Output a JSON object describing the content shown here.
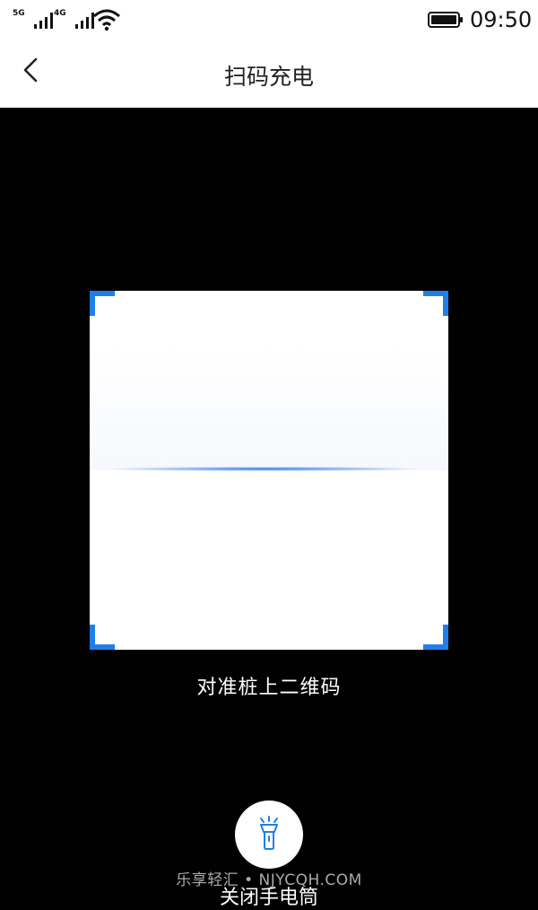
{
  "status_bar": {
    "network_1": "5G",
    "network_2": "4G",
    "time": "09:50",
    "icons": [
      "signal-5g-icon",
      "signal-4g-icon",
      "wifi-icon",
      "battery-icon"
    ]
  },
  "header": {
    "title": "扫码充电",
    "back_icon": "chevron-left-icon"
  },
  "scanner": {
    "hint": "对准桩上二维码",
    "accent_color": "#1f7fe8"
  },
  "flashlight": {
    "icon": "flashlight-icon",
    "label": "关闭手电筒"
  },
  "watermark": "乐享轻汇 • NJYCQH.COM"
}
